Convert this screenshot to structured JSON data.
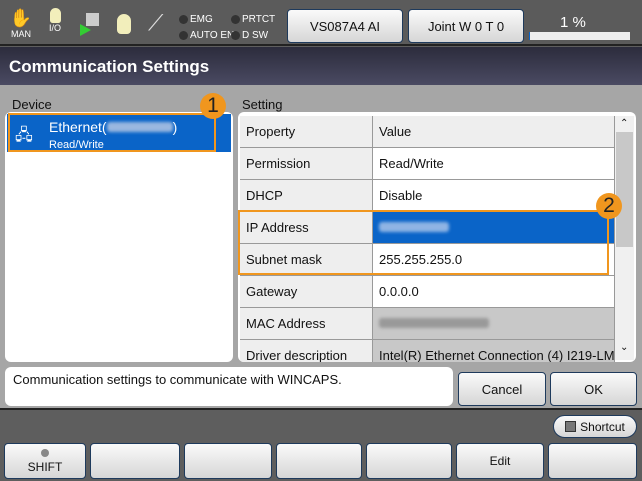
{
  "status_bar": {
    "mode_label": "MAN",
    "io_label": "I/O",
    "icons": [
      "hand-icon",
      "lightbulb-icon",
      "teach-pendant-icon",
      "lightbulb-icon",
      "wrench-icon"
    ],
    "leds": [
      "EMG",
      "PRTCT",
      "AUTO EN",
      "D SW"
    ],
    "robot_button": "VS087A4 AI",
    "joint_button": "Joint  W 0 T 0",
    "speed_percent": 1,
    "speed_label": "1 %"
  },
  "title": "Communication Settings",
  "device": {
    "label": "Device",
    "items": [
      {
        "name": "Ethernet(",
        "name_end": ")",
        "sub": "Read/Write",
        "icon": "network-icon",
        "selected": true
      }
    ]
  },
  "setting": {
    "label": "Setting",
    "headers": [
      "Property",
      "Value"
    ],
    "rows": [
      {
        "property": "Permission",
        "value": "Read/Write"
      },
      {
        "property": "DHCP",
        "value": "Disable"
      },
      {
        "property": "IP Address",
        "value": "",
        "selected": true
      },
      {
        "property": "Subnet mask",
        "value": "255.255.255.0"
      },
      {
        "property": "Gateway",
        "value": "0.0.0.0"
      },
      {
        "property": "MAC Address",
        "value": "",
        "readonly": true
      },
      {
        "property": "Driver description",
        "value": "Intel(R) Ethernet Connection (4) I219-LM",
        "readonly": true
      }
    ]
  },
  "annotations": [
    "1",
    "2"
  ],
  "message": "Communication settings to communicate with WINCAPS.",
  "buttons": {
    "cancel": "Cancel",
    "ok": "OK",
    "shortcut": "Shortcut"
  },
  "function_keys": [
    "SHIFT",
    "",
    "",
    "",
    "",
    "Edit",
    ""
  ],
  "colors": {
    "accent": "#f0961e",
    "selection": "#0a64c8"
  }
}
